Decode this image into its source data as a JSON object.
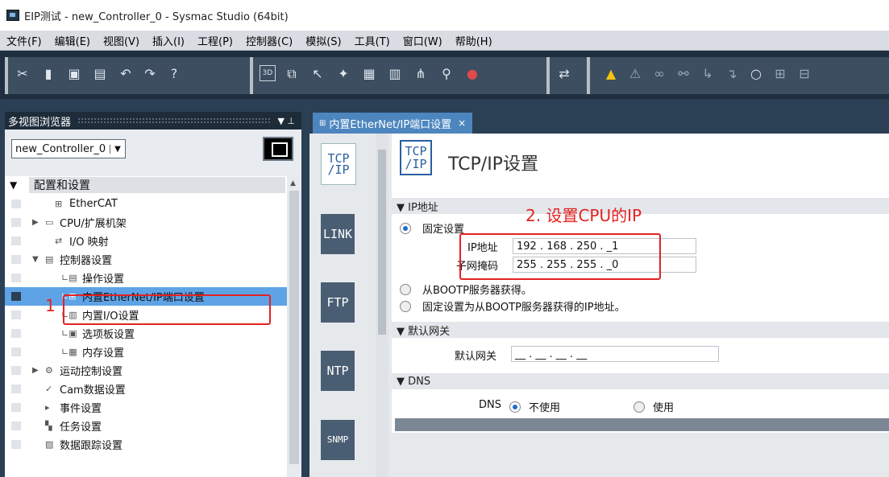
{
  "window": {
    "title": "EIP测试 - new_Controller_0 - Sysmac Studio (64bit)"
  },
  "menu": [
    "文件(F)",
    "编辑(E)",
    "视图(V)",
    "插入(I)",
    "工程(P)",
    "控制器(C)",
    "模拟(S)",
    "工具(T)",
    "窗口(W)",
    "帮助(H)"
  ],
  "toolbar": {
    "icons": [
      "cut-icon",
      "copy-icon",
      "paste-icon",
      "delete-icon",
      "undo-icon",
      "redo-icon",
      "help-icon",
      "3d-icon",
      "window-icon",
      "pointer-icon",
      "build-icon",
      "monitor-icon",
      "table-icon",
      "network-icon",
      "search-icon",
      "breakpoint-icon",
      "compare-icon",
      "warning-icon",
      "warning-dim-icon",
      "link-icon",
      "link2-icon",
      "step-icon",
      "step2-icon",
      "circle-icon",
      "sync-icon",
      "sync2-icon"
    ],
    "box_label": "3D"
  },
  "left": {
    "header": "多视图浏览器",
    "pin": "▼ ⊥",
    "controller": "new_Controller_0",
    "tree": [
      {
        "label": "配置和设置",
        "indent": 0
      },
      {
        "label": "EtherCAT",
        "indent": 1
      },
      {
        "label": "CPU/扩展机架",
        "indent": 1
      },
      {
        "label": "I/O 映射",
        "indent": 1
      },
      {
        "label": "控制器设置",
        "indent": 1
      },
      {
        "label": "操作设置",
        "indent": 2
      },
      {
        "label": "内置EtherNet/IP端口设置",
        "indent": 2
      },
      {
        "label": "内置I/O设置",
        "indent": 2
      },
      {
        "label": "选项板设置",
        "indent": 2
      },
      {
        "label": "内存设置",
        "indent": 2
      },
      {
        "label": "运动控制设置",
        "indent": 1
      },
      {
        "label": "Cam数据设置",
        "indent": 1
      },
      {
        "label": "事件设置",
        "indent": 1
      },
      {
        "label": "任务设置",
        "indent": 1
      },
      {
        "label": "数据跟踪设置",
        "indent": 1
      }
    ]
  },
  "tab": {
    "label": "内置EtherNet/IP端口设置",
    "close": "×"
  },
  "side_buttons": [
    {
      "label": "TCP\n/IP"
    },
    {
      "label": "LINK"
    },
    {
      "label": "FTP"
    },
    {
      "label": "NTP"
    },
    {
      "label": "SNMP"
    }
  ],
  "page": {
    "title_logo": "TCP\n/IP",
    "title": "TCP/IP设置",
    "ip_section": "▼ IP地址",
    "fixed": "固定设置",
    "ip_label": "IP地址",
    "ip_value": "192 . 168 . 250 . _1",
    "mask_label": "子网掩码",
    "mask_value": "255 . 255 . 255 . _0",
    "bootp": "从BOOTP服务器获得。",
    "bootp_fixed": "固定设置为从BOOTP服务器获得的IP地址。",
    "gateway_section": "▼ 默认网关",
    "gateway_label": "默认网关",
    "gateway_value": "__ . __ . __ . __",
    "dns_section": "▼ DNS",
    "dns_label": "DNS",
    "dns_off": "不使用",
    "dns_on": "使用"
  },
  "annotations": {
    "step1": "1",
    "step2": "2. 设置CPU的IP"
  }
}
